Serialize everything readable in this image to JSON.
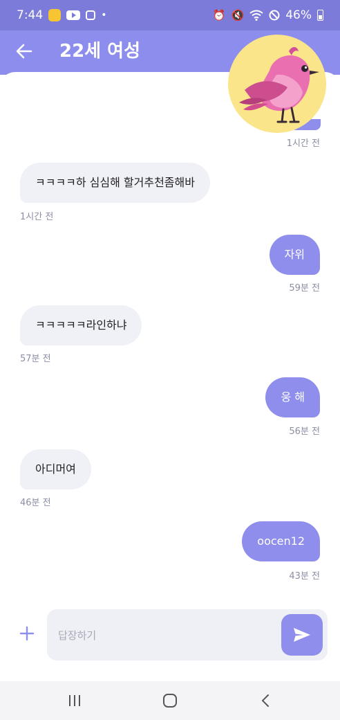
{
  "status_bar": {
    "time": "7:44",
    "battery": "46%",
    "icons": [
      "notification-badge-icon",
      "youtube-icon",
      "instagram-icon",
      "dot-icon",
      "alarm-icon",
      "mute-icon",
      "wifi-icon",
      "do-not-disturb-icon",
      "battery-icon"
    ]
  },
  "header": {
    "title": "22세 여성",
    "back_icon": "arrow-left-icon"
  },
  "messages": [
    {
      "side": "out",
      "text": "",
      "time": "1시간 전"
    },
    {
      "side": "in",
      "text": "ㅋㅋㅋㅋ하 심심해 할거추천좀해바",
      "time": "1시간 전"
    },
    {
      "side": "out",
      "text": "자위",
      "time": "59분 전"
    },
    {
      "side": "in",
      "text": "ㅋㅋㅋㅋㅋ라인하냐",
      "time": "57분 전"
    },
    {
      "side": "out",
      "text": "웅 해",
      "time": "56분 전"
    },
    {
      "side": "in",
      "text": "아디머여",
      "time": "46분 전"
    },
    {
      "side": "out",
      "text": "oocen12",
      "time": "43분 전"
    }
  ],
  "composer": {
    "placeholder": "답장하기",
    "value": "",
    "plus_icon": "plus-icon",
    "send_icon": "send-icon"
  },
  "nav_bar": {
    "buttons": [
      "recent-apps-icon",
      "home-icon",
      "back-icon"
    ]
  },
  "colors": {
    "accent": "#8f8eec",
    "header": "#8d8ded",
    "status_bar": "#7c7bd9",
    "incoming_bubble": "#f0f1f6"
  }
}
